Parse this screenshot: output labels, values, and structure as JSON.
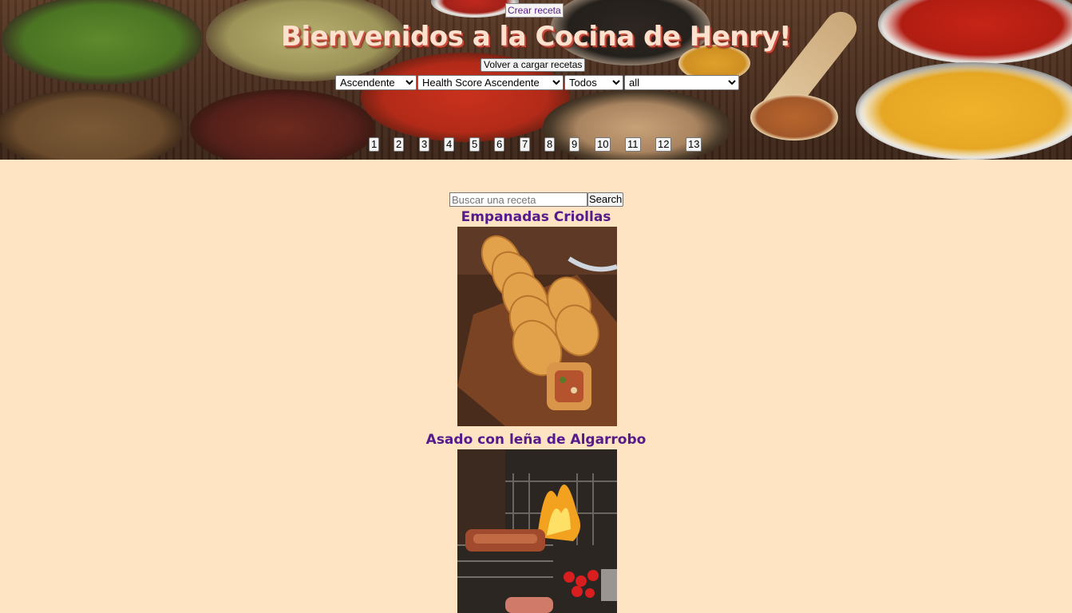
{
  "header": {
    "create_link": "Crear receta",
    "title": "Bienvenidos a la Cocina de Henry!",
    "reload_button": "Volver a cargar recetas",
    "filters": {
      "order": {
        "selected": "Ascendente"
      },
      "health_order": {
        "selected": "Health Score Ascendente"
      },
      "source": {
        "selected": "Todos"
      },
      "diet": {
        "selected": "all"
      }
    },
    "pagination": [
      "1",
      "2",
      "3",
      "4",
      "5",
      "6",
      "7",
      "8",
      "9",
      "10",
      "11",
      "12",
      "13"
    ]
  },
  "search": {
    "placeholder": "Buscar una receta",
    "value": "",
    "button": "Search"
  },
  "recipes": [
    {
      "title": "Empanadas Criollas"
    },
    {
      "title": "Asado con leña de Algarrobo"
    }
  ]
}
